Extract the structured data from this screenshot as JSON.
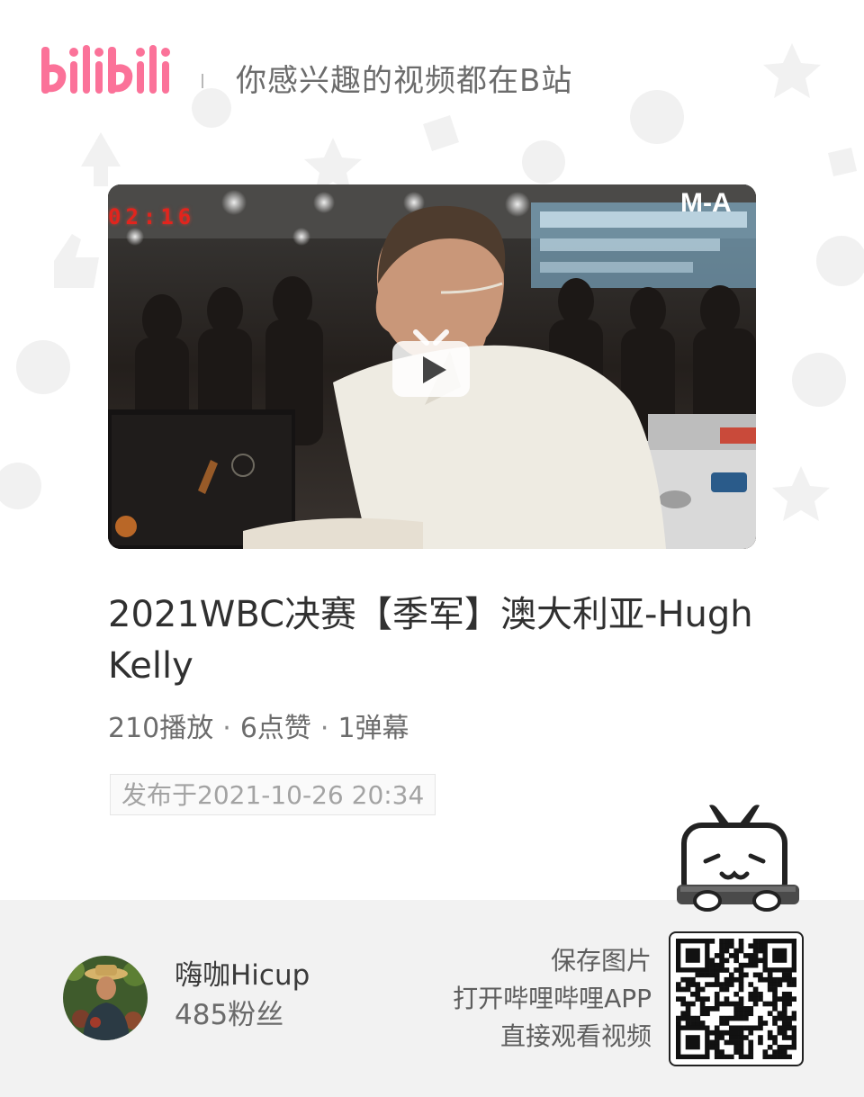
{
  "header": {
    "logo_text": "bilibili",
    "tagline": "你感兴趣的视频都在B站"
  },
  "video": {
    "overlay_timestamp": "02:16",
    "overlay_corner_text": "M-A"
  },
  "info": {
    "title": "2021WBC决赛【季军】澳大利亚-Hugh Kelly",
    "plays": "210播放",
    "likes": "6点赞",
    "danmaku": "1弹幕",
    "separator": "·",
    "published": "发布于2021-10-26 20:34"
  },
  "uploader": {
    "name": "嗨咖Hicup",
    "fans": "485粉丝"
  },
  "qr": {
    "line1": "保存图片",
    "line2": "打开哔哩哔哩APP",
    "line3": "直接观看视频"
  },
  "colors": {
    "brand_pink": "#fb7299",
    "text_dark": "#303030",
    "text_gray": "#6c6c6c",
    "footer_bg": "#f2f2f2"
  }
}
